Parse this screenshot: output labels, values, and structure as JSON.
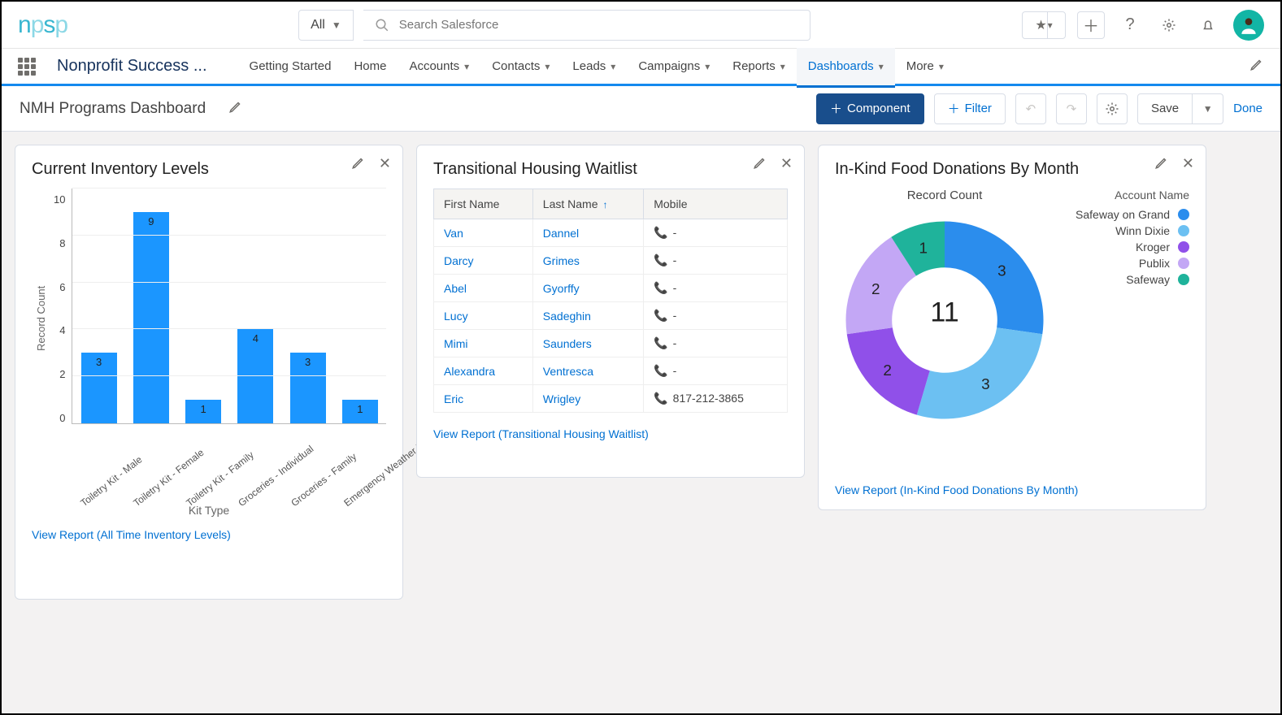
{
  "logo_text": "npsp",
  "search": {
    "scope": "All",
    "placeholder": "Search Salesforce"
  },
  "app_name": "Nonprofit Success ...",
  "nav_tabs": [
    {
      "label": "Getting Started",
      "drop": false
    },
    {
      "label": "Home",
      "drop": false
    },
    {
      "label": "Accounts",
      "drop": true
    },
    {
      "label": "Contacts",
      "drop": true
    },
    {
      "label": "Leads",
      "drop": true
    },
    {
      "label": "Campaigns",
      "drop": true
    },
    {
      "label": "Reports",
      "drop": true
    },
    {
      "label": "Dashboards",
      "drop": true,
      "active": true
    },
    {
      "label": "More",
      "drop": true
    }
  ],
  "dashboard_title": "NMH Programs Dashboard",
  "toolbar": {
    "component": "Component",
    "filter": "Filter",
    "save": "Save",
    "done": "Done"
  },
  "card1": {
    "title": "Current Inventory Levels",
    "ylabel": "Record Count",
    "xlabel": "Kit Type",
    "view_report": "View Report (All Time Inventory Levels)"
  },
  "card2": {
    "title": "Transitional Housing Waitlist",
    "cols": {
      "first": "First Name",
      "last": "Last Name",
      "mobile": "Mobile"
    },
    "rows": [
      {
        "first": "Van",
        "last": "Dannel",
        "mobile": "-"
      },
      {
        "first": "Darcy",
        "last": "Grimes",
        "mobile": "-"
      },
      {
        "first": "Abel",
        "last": "Gyorffy",
        "mobile": "-"
      },
      {
        "first": "Lucy",
        "last": "Sadeghin",
        "mobile": "-"
      },
      {
        "first": "Mimi",
        "last": "Saunders",
        "mobile": "-"
      },
      {
        "first": "Alexandra",
        "last": "Ventresca",
        "mobile": "-"
      },
      {
        "first": "Eric",
        "last": "Wrigley",
        "mobile": "817-212-3865"
      }
    ],
    "view_report": "View Report (Transitional Housing Waitlist)"
  },
  "card3": {
    "title": "In-Kind Food Donations By Month",
    "center_label": "Record Count",
    "total": "11",
    "legend_title": "Account Name",
    "legend": [
      {
        "name": "Safeway on Grand",
        "color": "#2b8ded"
      },
      {
        "name": "Winn Dixie",
        "color": "#6cc0f2"
      },
      {
        "name": "Kroger",
        "color": "#9050e9"
      },
      {
        "name": "Publix",
        "color": "#c3a7f5"
      },
      {
        "name": "Safeway",
        "color": "#1fb39b"
      }
    ],
    "view_report": "View Report (In-Kind Food Donations By Month)"
  },
  "chart_data": [
    {
      "type": "bar",
      "title": "Current Inventory Levels",
      "ylabel": "Record Count",
      "xlabel": "Kit Type",
      "ylim": [
        0,
        10
      ],
      "categories": [
        "Toiletry Kit - Male",
        "Toiletry Kit - Female",
        "Toiletry Kit - Family",
        "Groceries - Individual",
        "Groceries - Family",
        "Emergency Weather Kit"
      ],
      "values": [
        3,
        9,
        1,
        4,
        3,
        1
      ]
    },
    {
      "type": "pie",
      "title": "In-Kind Food Donations By Month",
      "center_label": "Record Count",
      "total": 11,
      "series": [
        {
          "name": "Safeway on Grand",
          "value": 3,
          "color": "#2b8ded"
        },
        {
          "name": "Winn Dixie",
          "value": 3,
          "color": "#6cc0f2"
        },
        {
          "name": "Kroger",
          "value": 2,
          "color": "#9050e9"
        },
        {
          "name": "Publix",
          "value": 2,
          "color": "#c3a7f5"
        },
        {
          "name": "Safeway",
          "value": 1,
          "color": "#1fb39b"
        }
      ]
    }
  ]
}
